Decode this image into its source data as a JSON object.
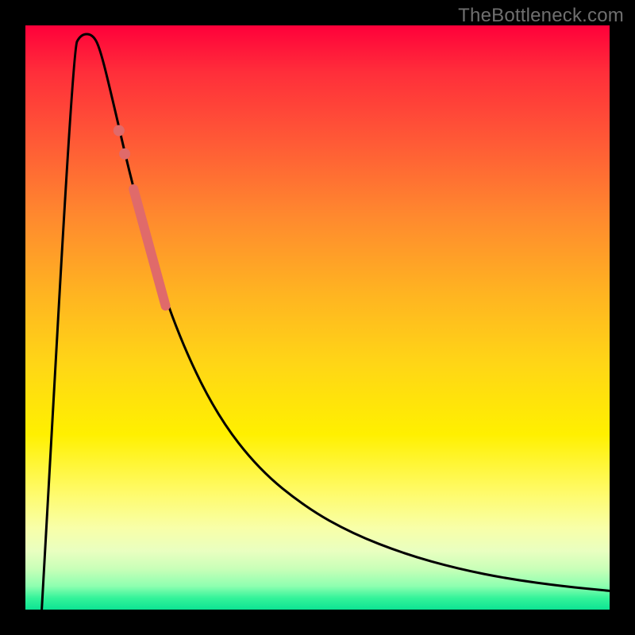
{
  "watermark": "TheBottleneck.com",
  "chart_data": {
    "type": "line",
    "title": "",
    "xlabel": "",
    "ylabel": "",
    "xlim": [
      0,
      1
    ],
    "ylim": [
      0,
      1
    ],
    "gradient_stops": [
      {
        "pos": 0.0,
        "color": "#ff003a"
      },
      {
        "pos": 0.08,
        "color": "#ff2e3a"
      },
      {
        "pos": 0.2,
        "color": "#ff5a36"
      },
      {
        "pos": 0.33,
        "color": "#ff8a2e"
      },
      {
        "pos": 0.46,
        "color": "#ffb421"
      },
      {
        "pos": 0.58,
        "color": "#ffd616"
      },
      {
        "pos": 0.7,
        "color": "#fff000"
      },
      {
        "pos": 0.8,
        "color": "#fffb6a"
      },
      {
        "pos": 0.86,
        "color": "#f8ffa8"
      },
      {
        "pos": 0.9,
        "color": "#e9ffc0"
      },
      {
        "pos": 0.93,
        "color": "#c9ffb8"
      },
      {
        "pos": 0.96,
        "color": "#8dffb0"
      },
      {
        "pos": 0.98,
        "color": "#34f39a"
      },
      {
        "pos": 1.0,
        "color": "#0de493"
      }
    ],
    "series": [
      {
        "name": "curve",
        "color": "#000000",
        "stroke_width": 3,
        "points": [
          {
            "x": 0.028,
            "y": 0.0
          },
          {
            "x": 0.082,
            "y": 0.96
          },
          {
            "x": 0.095,
            "y": 0.985
          },
          {
            "x": 0.115,
            "y": 0.985
          },
          {
            "x": 0.128,
            "y": 0.96
          },
          {
            "x": 0.15,
            "y": 0.87
          },
          {
            "x": 0.18,
            "y": 0.74
          },
          {
            "x": 0.22,
            "y": 0.59
          },
          {
            "x": 0.27,
            "y": 0.45
          },
          {
            "x": 0.33,
            "y": 0.33
          },
          {
            "x": 0.4,
            "y": 0.24
          },
          {
            "x": 0.48,
            "y": 0.175
          },
          {
            "x": 0.56,
            "y": 0.13
          },
          {
            "x": 0.65,
            "y": 0.095
          },
          {
            "x": 0.74,
            "y": 0.07
          },
          {
            "x": 0.83,
            "y": 0.052
          },
          {
            "x": 0.92,
            "y": 0.04
          },
          {
            "x": 1.0,
            "y": 0.032
          }
        ]
      }
    ],
    "highlight_segment": {
      "color": "#e06a6a",
      "stroke_width": 12,
      "points": [
        {
          "x": 0.185,
          "y": 0.72
        },
        {
          "x": 0.24,
          "y": 0.52
        }
      ]
    },
    "highlight_dots": {
      "color": "#e06a6a",
      "radius": 7,
      "points": [
        {
          "x": 0.16,
          "y": 0.82
        },
        {
          "x": 0.17,
          "y": 0.78
        }
      ]
    }
  }
}
